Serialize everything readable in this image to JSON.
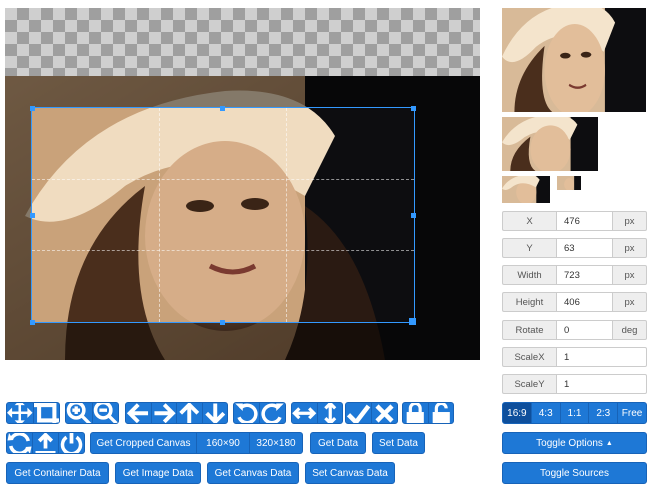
{
  "preview_panel": {
    "fields": [
      {
        "label": "X",
        "value": "476",
        "unit": "px"
      },
      {
        "label": "Y",
        "value": "63",
        "unit": "px"
      },
      {
        "label": "Width",
        "value": "723",
        "unit": "px"
      },
      {
        "label": "Height",
        "value": "406",
        "unit": "px"
      },
      {
        "label": "Rotate",
        "value": "0",
        "unit": "deg"
      },
      {
        "label": "ScaleX",
        "value": "1",
        "unit": ""
      },
      {
        "label": "ScaleY",
        "value": "1",
        "unit": ""
      }
    ],
    "aspect_ratios": [
      "16:9",
      "4:3",
      "1:1",
      "2:3",
      "Free"
    ],
    "active_ratio": "16:9",
    "toggle_options_label": "Toggle Options",
    "toggle_sources_label": "Toggle Sources"
  },
  "toolbar": {
    "row1_icons": [
      "move-icon",
      "crop-icon",
      "zoom-in-icon",
      "zoom-out-icon",
      "arrow-left-icon",
      "arrow-right-icon",
      "arrow-up-icon",
      "arrow-down-icon",
      "rotate-left-icon",
      "rotate-right-icon",
      "flip-horizontal-icon",
      "flip-vertical-icon",
      "check-icon",
      "clear-icon",
      "lock-icon",
      "unlock-icon"
    ],
    "row2_icons": [
      "reset-icon",
      "upload-icon",
      "power-icon"
    ],
    "get_cropped_canvas_label": "Get Cropped Canvas",
    "size_160_label": "160×90",
    "size_320_label": "320×180",
    "get_data_label": "Get Data",
    "set_data_label": "Set Data",
    "get_container_data_label": "Get Container Data",
    "get_image_data_label": "Get Image Data",
    "get_canvas_data_label": "Get Canvas Data",
    "set_canvas_data_label": "Set Canvas Data"
  },
  "colors": {
    "primary": "#1e78d6",
    "active_ratio": "#0e4f9c",
    "crop_outline": "#3399ff"
  }
}
